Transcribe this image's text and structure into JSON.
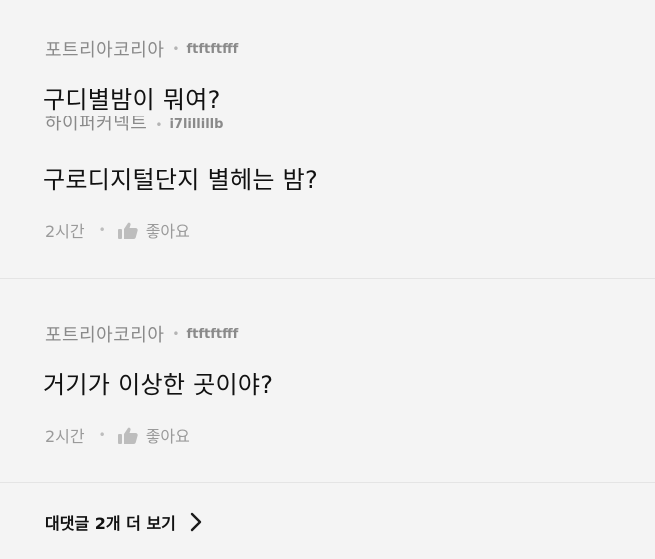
{
  "comments": [
    {
      "author": "포트리아코리아",
      "author_id": "ftftftfff",
      "text": "구디별밤이 뭐여?"
    },
    {
      "author": "하이퍼커넥트",
      "author_id": "i7lillillb",
      "text": "구로디지털단지 별헤는 밤?",
      "time": "2시간",
      "like_label": "좋아요"
    },
    {
      "author": "포트리아코리아",
      "author_id": "ftftftfff",
      "text": "거기가 이상한 곳이야?",
      "time": "2시간",
      "like_label": "좋아요"
    }
  ],
  "more_replies_label": "대댓글 2개 더 보기",
  "separator": "•",
  "icons": {
    "like": "thumbs-up-icon",
    "more": "chevron-right-icon"
  }
}
